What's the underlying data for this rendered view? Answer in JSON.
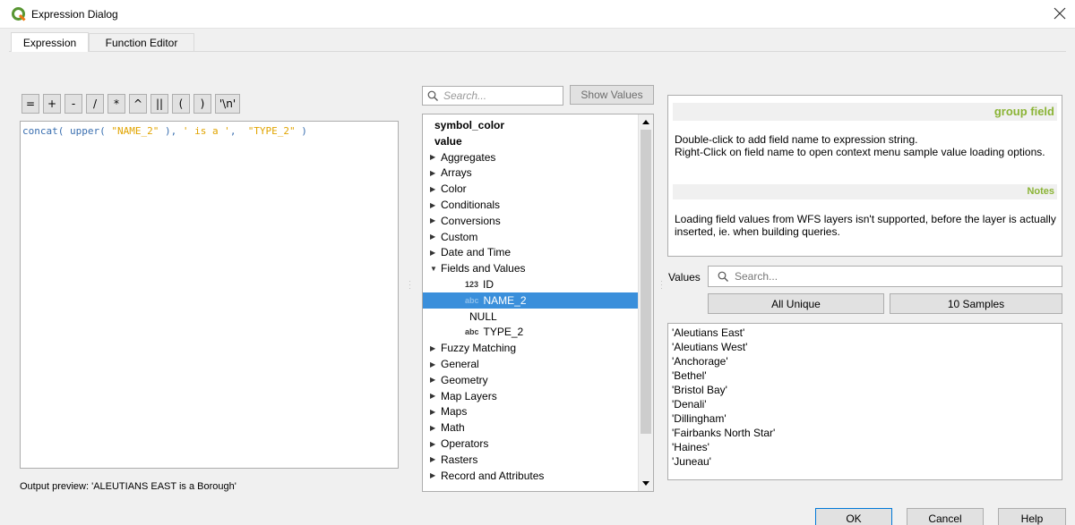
{
  "window": {
    "title": "Expression Dialog"
  },
  "tabs": [
    {
      "label": "Expression"
    },
    {
      "label": "Function Editor"
    }
  ],
  "operators": [
    "=",
    "+",
    "-",
    "/",
    "*",
    "^",
    "||",
    "(",
    ")",
    "'\\n'"
  ],
  "editor": {
    "tokens": [
      {
        "t": "concat( upper( ",
        "c": "fn"
      },
      {
        "t": "\"NAME_2\"",
        "c": "str"
      },
      {
        "t": " ), ",
        "c": "fn"
      },
      {
        "t": "' is a '",
        "c": "str"
      },
      {
        "t": ",  ",
        "c": "fn"
      },
      {
        "t": "\"TYPE_2\"",
        "c": "str"
      },
      {
        "t": " )",
        "c": "fn"
      }
    ]
  },
  "output_preview": "Output preview:  'ALEUTIANS EAST is a Borough'",
  "function_search": {
    "placeholder": "Search..."
  },
  "show_values_label": "Show Values",
  "tree": [
    {
      "label": "symbol_color",
      "kind": "bold"
    },
    {
      "label": "value",
      "kind": "bold"
    },
    {
      "label": "Aggregates",
      "kind": "group"
    },
    {
      "label": "Arrays",
      "kind": "group"
    },
    {
      "label": "Color",
      "kind": "group"
    },
    {
      "label": "Conditionals",
      "kind": "group"
    },
    {
      "label": "Conversions",
      "kind": "group"
    },
    {
      "label": "Custom",
      "kind": "group"
    },
    {
      "label": "Date and Time",
      "kind": "group"
    },
    {
      "label": "Fields and Values",
      "kind": "open"
    },
    {
      "label": "ID",
      "kind": "child",
      "type": "123"
    },
    {
      "label": "NAME_2",
      "kind": "child",
      "type": "abc",
      "selected": true
    },
    {
      "label": "NULL",
      "kind": "child",
      "type": ""
    },
    {
      "label": "TYPE_2",
      "kind": "child",
      "type": "abc"
    },
    {
      "label": "Fuzzy Matching",
      "kind": "group"
    },
    {
      "label": "General",
      "kind": "group"
    },
    {
      "label": "Geometry",
      "kind": "group"
    },
    {
      "label": "Map Layers",
      "kind": "group"
    },
    {
      "label": "Maps",
      "kind": "group"
    },
    {
      "label": "Math",
      "kind": "group"
    },
    {
      "label": "Operators",
      "kind": "group"
    },
    {
      "label": "Rasters",
      "kind": "group"
    },
    {
      "label": "Record and Attributes",
      "kind": "group"
    }
  ],
  "help": {
    "group_title": "group field",
    "group_text_1": "Double-click to add field name to expression string.",
    "group_text_2": "Right-Click on field name to open context menu sample value loading options.",
    "notes_title": "Notes",
    "notes_text": "Loading field values from WFS layers isn't supported, before the layer is actually inserted, ie. when building queries."
  },
  "values_panel": {
    "label": "Values",
    "search_placeholder": "Search...",
    "all_unique_label": "All Unique",
    "samples_label": "10 Samples",
    "items": [
      "'Aleutians East'",
      "'Aleutians West'",
      "'Anchorage'",
      "'Bethel'",
      "'Bristol Bay'",
      "'Denali'",
      "'Dillingham'",
      "'Fairbanks North Star'",
      "'Haines'",
      "'Juneau'"
    ]
  },
  "buttons": {
    "ok": "OK",
    "cancel": "Cancel",
    "help": "Help"
  },
  "colors": {
    "accent_header": "#8bb436",
    "selection": "#3a8fdb",
    "string_literal": "#e1a400",
    "code": "#3a6fb0"
  }
}
